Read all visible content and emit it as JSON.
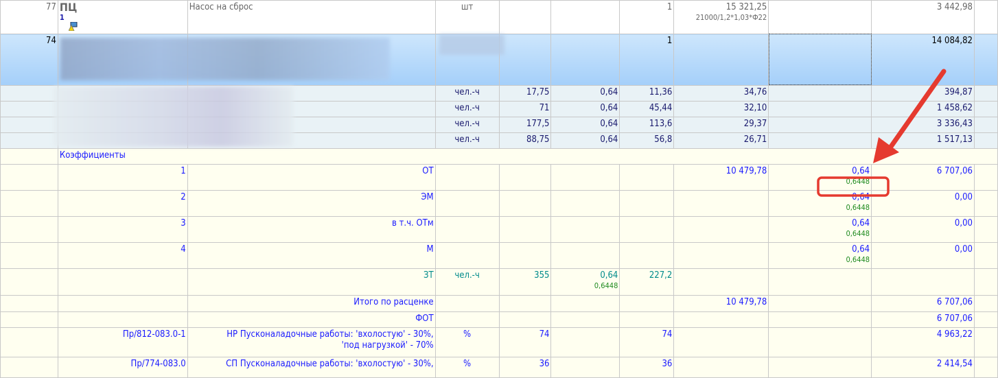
{
  "colors": {
    "accent_red": "#e53a2f",
    "link_blue": "#1a1aff",
    "green": "#1f8a1f",
    "teal": "#008b8b"
  },
  "rows": [
    {
      "type": "top",
      "h": 49,
      "cells": [
        {
          "t": "77"
        },
        {
          "t": "ПЦ",
          "sub": "1",
          "cls": "l big"
        },
        {
          "t": "Насос на сброс",
          "cls": "l"
        },
        {
          "t": "шт",
          "cls": "c"
        },
        {
          "t": ""
        },
        {
          "t": ""
        },
        {
          "t": "1"
        },
        {
          "t": "15 321,25",
          "sub": "21000/1,2*1,03*Ф22"
        },
        {
          "t": ""
        },
        {
          "t": "3 442,98"
        },
        {
          "t": ""
        }
      ]
    },
    {
      "type": "sel",
      "h": 75,
      "cells": [
        {
          "t": "74"
        },
        {
          "t": ""
        },
        {
          "t": ""
        },
        {
          "t": ""
        },
        {
          "t": ""
        },
        {
          "t": ""
        },
        {
          "t": "1"
        },
        {
          "t": ""
        },
        {
          "t": ""
        },
        {
          "t": "14 084,82"
        },
        {
          "t": ""
        }
      ]
    },
    {
      "type": "res",
      "h": 23,
      "cells": [
        {
          "t": ""
        },
        {
          "t": ""
        },
        {
          "t": ""
        },
        {
          "t": "чел.-ч",
          "cls": "c"
        },
        {
          "t": "17,75"
        },
        {
          "t": "0,64"
        },
        {
          "t": "11,36"
        },
        {
          "t": "34,76"
        },
        {
          "t": ""
        },
        {
          "t": "394,87"
        },
        {
          "t": ""
        }
      ]
    },
    {
      "type": "res",
      "h": 23,
      "cells": [
        {
          "t": ""
        },
        {
          "t": ""
        },
        {
          "t": ""
        },
        {
          "t": "чел.-ч",
          "cls": "c"
        },
        {
          "t": "71"
        },
        {
          "t": "0,64"
        },
        {
          "t": "45,44"
        },
        {
          "t": "32,10"
        },
        {
          "t": ""
        },
        {
          "t": "1 458,62"
        },
        {
          "t": ""
        }
      ]
    },
    {
      "type": "res",
      "h": 23,
      "cells": [
        {
          "t": ""
        },
        {
          "t": ""
        },
        {
          "t": ""
        },
        {
          "t": "чел.-ч",
          "cls": "c"
        },
        {
          "t": "177,5"
        },
        {
          "t": "0,64"
        },
        {
          "t": "113,6"
        },
        {
          "t": "29,37"
        },
        {
          "t": ""
        },
        {
          "t": "3 336,43"
        },
        {
          "t": ""
        }
      ]
    },
    {
      "type": "res",
      "h": 23,
      "cells": [
        {
          "t": ""
        },
        {
          "t": ""
        },
        {
          "t": ""
        },
        {
          "t": "чел.-ч",
          "cls": "c"
        },
        {
          "t": "88,75"
        },
        {
          "t": "0,64"
        },
        {
          "t": "56,8"
        },
        {
          "t": "26,71"
        },
        {
          "t": ""
        },
        {
          "t": "1 517,13"
        },
        {
          "t": ""
        }
      ]
    },
    {
      "type": "y",
      "h": 23,
      "span": true,
      "cells": [
        {
          "t": ""
        },
        {
          "t": "Коэффициенты",
          "cls": "l"
        }
      ]
    },
    {
      "type": "y",
      "h": 38,
      "cells": [
        {
          "t": ""
        },
        {
          "t": "1"
        },
        {
          "t": "ОТ"
        },
        {
          "t": ""
        },
        {
          "t": ""
        },
        {
          "t": ""
        },
        {
          "t": ""
        },
        {
          "t": "10 479,78"
        },
        {
          "t": "0,64",
          "sub": "0,6448"
        },
        {
          "t": "6 707,06"
        },
        {
          "t": ""
        }
      ]
    },
    {
      "type": "y",
      "h": 38,
      "cells": [
        {
          "t": ""
        },
        {
          "t": "2"
        },
        {
          "t": "ЭМ"
        },
        {
          "t": ""
        },
        {
          "t": ""
        },
        {
          "t": ""
        },
        {
          "t": ""
        },
        {
          "t": ""
        },
        {
          "t": "0,64",
          "sub": "0,6448"
        },
        {
          "t": "0,00"
        },
        {
          "t": ""
        }
      ]
    },
    {
      "type": "y",
      "h": 38,
      "cells": [
        {
          "t": ""
        },
        {
          "t": "3"
        },
        {
          "t": "в т.ч. ОТм"
        },
        {
          "t": ""
        },
        {
          "t": ""
        },
        {
          "t": ""
        },
        {
          "t": ""
        },
        {
          "t": ""
        },
        {
          "t": "0,64",
          "sub": "0,6448"
        },
        {
          "t": "0,00"
        },
        {
          "t": ""
        }
      ]
    },
    {
      "type": "y",
      "h": 38,
      "cells": [
        {
          "t": ""
        },
        {
          "t": "4"
        },
        {
          "t": "М"
        },
        {
          "t": ""
        },
        {
          "t": ""
        },
        {
          "t": ""
        },
        {
          "t": ""
        },
        {
          "t": ""
        },
        {
          "t": "0,64",
          "sub": "0,6448"
        },
        {
          "t": "0,00"
        },
        {
          "t": ""
        }
      ]
    },
    {
      "type": "y",
      "h": 39,
      "cells": [
        {
          "t": ""
        },
        {
          "t": ""
        },
        {
          "t": "ЗТ",
          "cls": "teal"
        },
        {
          "t": "чел.-ч",
          "cls": "c teal"
        },
        {
          "t": "355",
          "cls": "teal"
        },
        {
          "t": "0,64",
          "sub": "0,6448",
          "cls": "teal"
        },
        {
          "t": "227,2",
          "cls": "teal"
        },
        {
          "t": ""
        },
        {
          "t": ""
        },
        {
          "t": ""
        },
        {
          "t": ""
        }
      ]
    },
    {
      "type": "y",
      "h": 24,
      "cells": [
        {
          "t": ""
        },
        {
          "t": ""
        },
        {
          "t": "Итого по расценке"
        },
        {
          "t": ""
        },
        {
          "t": ""
        },
        {
          "t": ""
        },
        {
          "t": ""
        },
        {
          "t": "10 479,78"
        },
        {
          "t": ""
        },
        {
          "t": "6 707,06"
        },
        {
          "t": ""
        }
      ]
    },
    {
      "type": "y",
      "h": 23,
      "cells": [
        {
          "t": ""
        },
        {
          "t": ""
        },
        {
          "t": "ФОТ"
        },
        {
          "t": ""
        },
        {
          "t": ""
        },
        {
          "t": ""
        },
        {
          "t": ""
        },
        {
          "t": ""
        },
        {
          "t": ""
        },
        {
          "t": "6 707,06"
        },
        {
          "t": ""
        }
      ]
    },
    {
      "type": "y",
      "h": 43,
      "cells": [
        {
          "t": ""
        },
        {
          "t": "Пр/812-083.0-1"
        },
        {
          "t": "НР Пусконаладочные работы: 'вхолостую' - 30%,",
          "sub": "'под нагрузкой' - 70%",
          "subblue": true
        },
        {
          "t": "%",
          "cls": "c"
        },
        {
          "t": "74"
        },
        {
          "t": ""
        },
        {
          "t": "74"
        },
        {
          "t": ""
        },
        {
          "t": ""
        },
        {
          "t": "4 963,22"
        },
        {
          "t": ""
        }
      ]
    },
    {
      "type": "y",
      "h": 30,
      "cells": [
        {
          "t": ""
        },
        {
          "t": "Пр/774-083.0"
        },
        {
          "t": "СП Пусконаладочные работы: 'вхолостую' - 30%,"
        },
        {
          "t": "%",
          "cls": "c"
        },
        {
          "t": "36"
        },
        {
          "t": ""
        },
        {
          "t": "36"
        },
        {
          "t": ""
        },
        {
          "t": ""
        },
        {
          "t": "2 414,54"
        },
        {
          "t": ""
        }
      ]
    }
  ]
}
